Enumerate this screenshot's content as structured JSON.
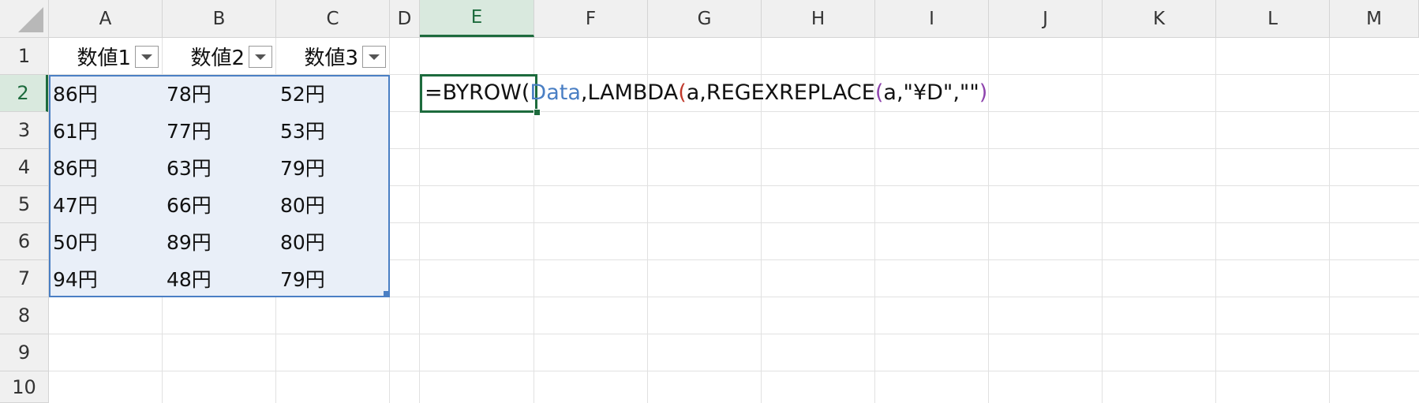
{
  "column_headers": [
    "A",
    "B",
    "C",
    "D",
    "E",
    "F",
    "G",
    "H",
    "I",
    "J",
    "K",
    "L",
    "M"
  ],
  "row_headers": [
    "1",
    "2",
    "3",
    "4",
    "5",
    "6",
    "7",
    "8",
    "9",
    "10"
  ],
  "active_column": "E",
  "active_row": "2",
  "table": {
    "name": "Data",
    "headers": [
      "数値1",
      "数値2",
      "数値3"
    ],
    "rows": [
      [
        "86円",
        "78円",
        "52円"
      ],
      [
        "61円",
        "77円",
        "53円"
      ],
      [
        "86円",
        "63円",
        "79円"
      ],
      [
        "47円",
        "66円",
        "80円"
      ],
      [
        "50円",
        "89円",
        "80円"
      ],
      [
        "94円",
        "48円",
        "79円"
      ]
    ]
  },
  "formula": {
    "p1": "=BYROW(",
    "p2": "Data",
    "p3": ",LAMBDA",
    "p4": "(",
    "p5": "a,REGEXREPLACE",
    "p6": "(",
    "p7": "a,\"¥D\",\"\"",
    "p8": ")"
  }
}
